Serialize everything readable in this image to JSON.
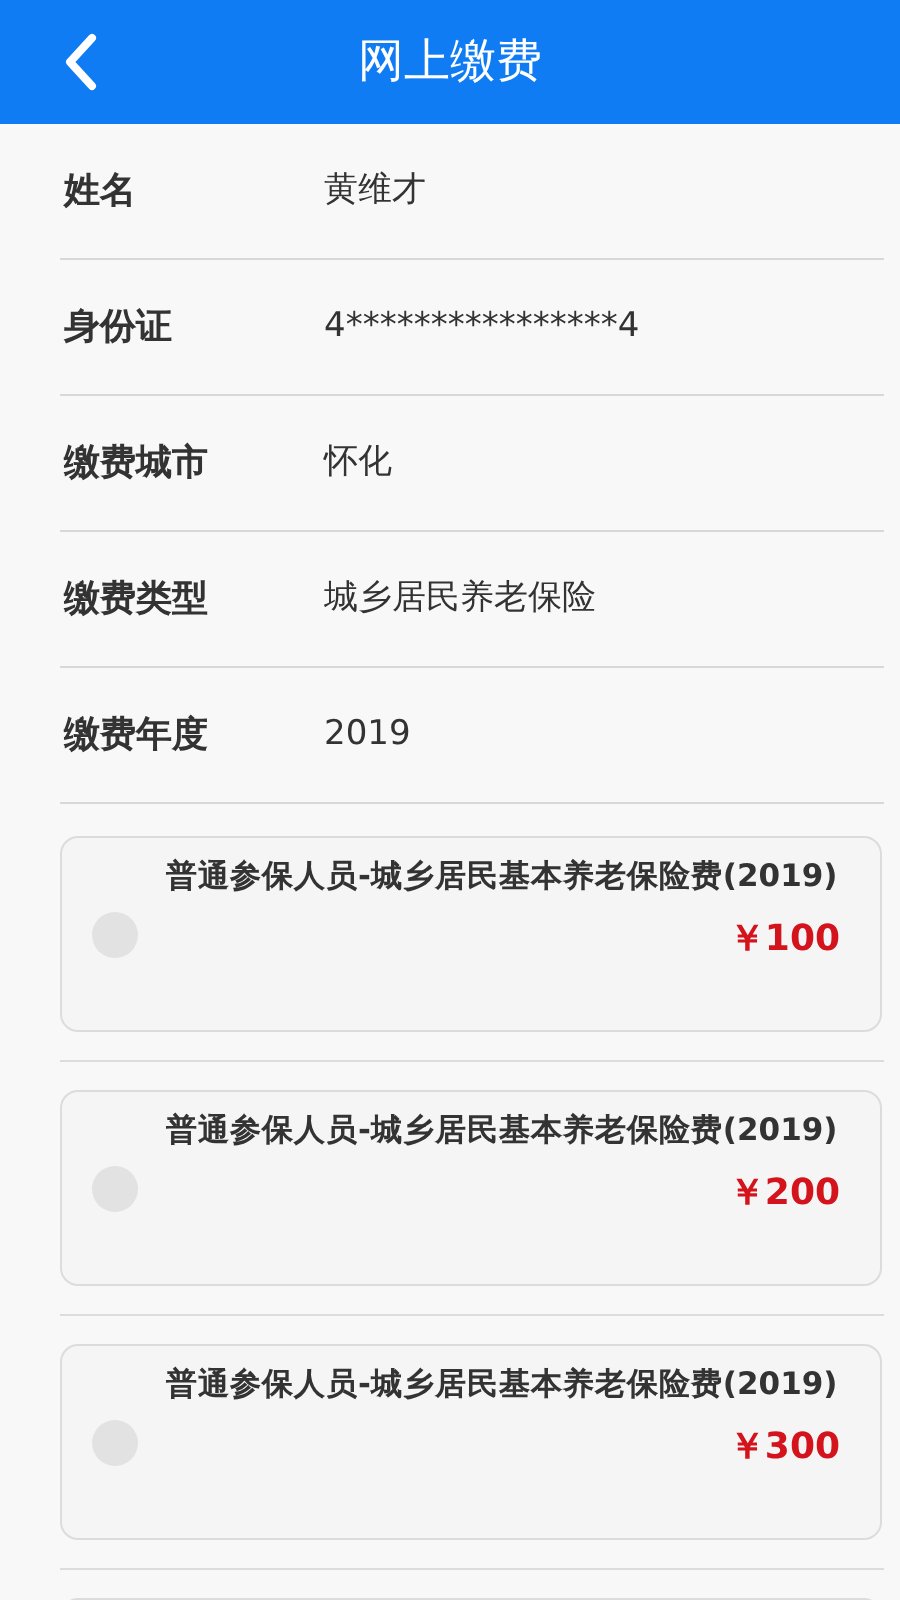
{
  "header": {
    "title": "网上缴费"
  },
  "fields": [
    {
      "label": "姓名",
      "value": "黄维才"
    },
    {
      "label": "身份证",
      "value": "4****************4"
    },
    {
      "label": "缴费城市",
      "value": "怀化"
    },
    {
      "label": "缴费类型",
      "value": "城乡居民养老保险"
    },
    {
      "label": "缴费年度",
      "value": "2019"
    }
  ],
  "items": [
    {
      "title": "普通参保人员-城乡居民基本养老保险费(2019)",
      "price": "￥100",
      "selected": false
    },
    {
      "title": "普通参保人员-城乡居民基本养老保险费(2019)",
      "price": "￥200",
      "selected": false
    },
    {
      "title": "普通参保人员-城乡居民基本养老保险费(2019)",
      "price": "￥300",
      "selected": false
    }
  ]
}
